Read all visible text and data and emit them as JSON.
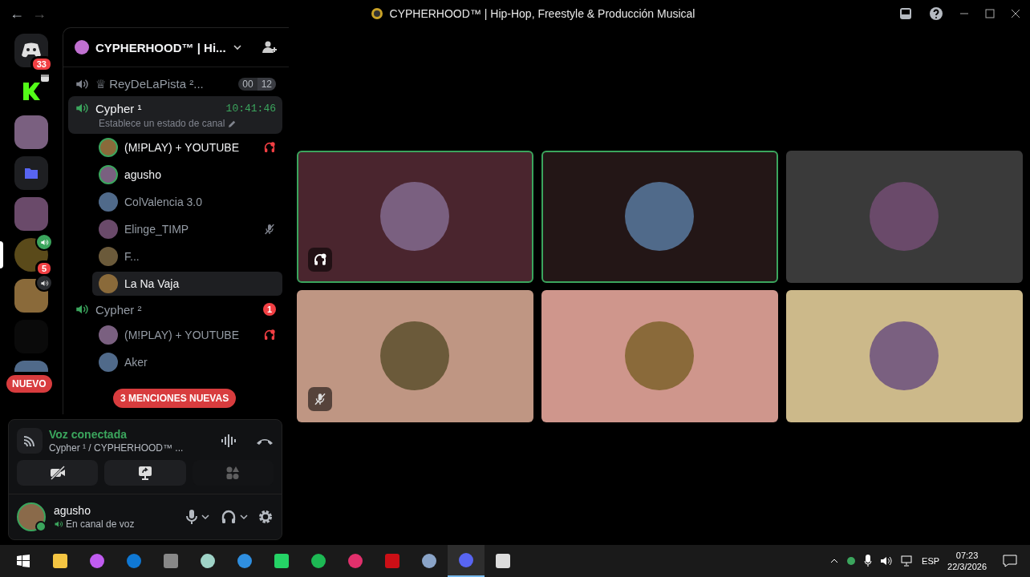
{
  "title_bar": {
    "back": "←",
    "forward": "→",
    "title": "CYPHERHOOD™ | Hip-Hop, Freestyle & Producción Musical"
  },
  "servers": [
    {
      "kind": "home",
      "badge": "33",
      "voice": false,
      "selected": false
    },
    {
      "kind": "k",
      "voice": false,
      "selected": false
    },
    {
      "kind": "photo",
      "voice": false,
      "selected": false
    },
    {
      "kind": "folder",
      "voice": false,
      "selected": false
    },
    {
      "kind": "photo",
      "voice": false,
      "selected": false
    },
    {
      "kind": "ch",
      "badge": "5",
      "voice": true,
      "live": true,
      "selected": true
    },
    {
      "kind": "photo",
      "voice": true,
      "live": false,
      "selected": false
    },
    {
      "kind": "blank",
      "voice": false,
      "selected": false
    },
    {
      "kind": "photo",
      "voice": false,
      "selected": false
    }
  ],
  "new_pill": "NUEVO",
  "server_header": {
    "name": "CYPHERHOOD™ | Hi..."
  },
  "channels": [
    {
      "name": "♕ ReyDeLaPista ²...",
      "live": false,
      "selected": false,
      "counts": [
        "00",
        "12"
      ]
    },
    {
      "name": "Cypher ¹",
      "live": true,
      "selected": true,
      "timer": "10:41:46",
      "status": "Establece un estado de canal",
      "members": [
        {
          "name": "(M!PLAY) + YOUTUBE",
          "speaking": true,
          "selected": false,
          "deafened": true,
          "muted": false
        },
        {
          "name": "agusho",
          "speaking": true,
          "selected": false,
          "deafened": false,
          "muted": false
        },
        {
          "name": "ColValencia 3.0",
          "speaking": false,
          "selected": false,
          "deafened": false,
          "muted": false
        },
        {
          "name": "Elinge_TIMP",
          "speaking": false,
          "selected": false,
          "deafened": false,
          "muted": true
        },
        {
          "name": "F...",
          "speaking": false,
          "selected": false,
          "deafened": false,
          "muted": false
        },
        {
          "name": "La Na Vaja",
          "speaking": false,
          "selected": true,
          "deafened": false,
          "muted": false
        }
      ]
    },
    {
      "name": "Cypher ²",
      "live": true,
      "selected": false,
      "badge": "1",
      "members": [
        {
          "name": "(M!PLAY) + YOUTUBE",
          "speaking": false,
          "selected": false,
          "deafened": true,
          "muted": false
        },
        {
          "name": "Aker",
          "speaking": false,
          "selected": false,
          "deafened": false,
          "muted": false
        }
      ]
    }
  ],
  "mentions_pill": "3 MENCIONES NUEVAS",
  "voice_panel": {
    "status": "Voz conectada",
    "location": "Cypher ¹ / CYPHERHOOD™ ...",
    "activities_disabled": true
  },
  "user_panel": {
    "name": "agusho",
    "status": "En canal de voz"
  },
  "tiles": [
    {
      "color": "#4a252e",
      "speaking": true,
      "deafened": true,
      "muted": false
    },
    {
      "color": "#231616",
      "speaking": true,
      "deafened": false,
      "muted": false
    },
    {
      "color": "#3a3a3a",
      "speaking": false,
      "deafened": false,
      "muted": false
    },
    {
      "color": "#bf9683",
      "speaking": false,
      "deafened": false,
      "muted": true
    },
    {
      "color": "#cf968c",
      "speaking": false,
      "deafened": false,
      "muted": false
    },
    {
      "color": "#ccb98a",
      "speaking": false,
      "deafened": false,
      "muted": false
    }
  ],
  "taskbar": {
    "language": "ESP",
    "time": "07:23",
    "date": "22/3/2026"
  }
}
